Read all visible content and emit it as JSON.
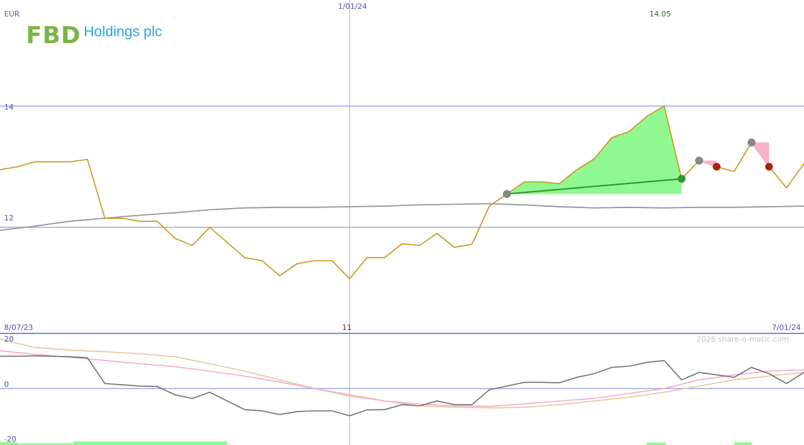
{
  "logo": {
    "letters": "FBD",
    "word": "Holdings plc"
  },
  "copyright": "2026 share-o-matic.com",
  "colors": {
    "price": "#c8941c",
    "ma": "#999999",
    "gain_fill": "#90f890",
    "gain_line": "#2a9a2a",
    "loss_fill": "#f8b4c8",
    "loss_marker": "#b02010",
    "neutral_marker": "#888888",
    "gridline": "#a0a8e8",
    "axis_text": "#4b55b0",
    "date_text": "#4b55b0",
    "accent_text": "#207020",
    "osc_price": "#707070",
    "osc_pink": "#f4a8c8",
    "osc_tan": "#e4c89c",
    "volume": "#90f890"
  },
  "chart_data": [
    {
      "type": "line",
      "name": "price-panel",
      "currency_label": "EUR",
      "ylim": [
        10.25,
        15.75
      ],
      "yticks": [
        {
          "value": 14,
          "label": "14"
        },
        {
          "value": 12,
          "label": "12"
        }
      ],
      "x_start_label": "8/07/23",
      "x_mid_label": "1/01/24",
      "x_end_label": "7/01/24",
      "highlight_label": "14.05",
      "x_range": [
        0,
        46
      ],
      "x_mid_index": 20,
      "price_series": {
        "x": [
          0,
          1,
          2,
          3,
          4,
          5,
          6,
          7,
          8,
          9,
          10,
          11,
          12,
          13,
          14,
          15,
          16,
          17,
          18,
          19,
          20,
          21,
          22,
          23,
          24,
          25,
          26,
          27,
          28,
          29,
          30,
          31,
          32,
          33,
          34,
          35,
          36,
          37,
          38,
          39,
          40,
          41,
          42,
          43,
          44,
          45,
          46
        ],
        "y": [
          12.95,
          13.0,
          13.08,
          13.08,
          13.08,
          13.12,
          12.15,
          12.15,
          12.1,
          12.1,
          11.82,
          11.7,
          12.0,
          11.75,
          11.5,
          11.45,
          11.2,
          11.4,
          11.45,
          11.45,
          11.15,
          11.5,
          11.5,
          11.73,
          11.7,
          11.9,
          11.67,
          11.72,
          12.35,
          12.55,
          12.75,
          12.75,
          12.72,
          12.95,
          13.13,
          13.48,
          13.58,
          13.83,
          14.0,
          12.8,
          13.1,
          13.0,
          12.92,
          13.4,
          13.0,
          12.65,
          13.05
        ]
      },
      "ma_series": {
        "x": [
          0,
          2,
          4,
          6,
          8,
          10,
          12,
          14,
          16,
          18,
          20,
          22,
          24,
          26,
          28,
          30,
          32,
          34,
          36,
          38,
          40,
          42,
          44,
          46
        ],
        "y": [
          11.95,
          12.02,
          12.1,
          12.15,
          12.2,
          12.24,
          12.29,
          12.32,
          12.33,
          12.33,
          12.34,
          12.35,
          12.37,
          12.38,
          12.39,
          12.37,
          12.34,
          12.32,
          12.33,
          12.32,
          12.33,
          12.33,
          12.34,
          12.35
        ]
      },
      "trades": [
        {
          "type": "gain",
          "entry": {
            "x": 29,
            "y": 12.55
          },
          "exit": {
            "x": 39,
            "y": 12.8
          }
        },
        {
          "type": "loss",
          "entry": {
            "x": 40,
            "y": 13.1
          },
          "exit": {
            "x": 41,
            "y": 13.0
          }
        },
        {
          "type": "loss",
          "entry": {
            "x": 43,
            "y": 13.4
          },
          "exit": {
            "x": 44,
            "y": 13.0
          }
        }
      ]
    },
    {
      "type": "line",
      "name": "oscillator-panel",
      "center_label": "11",
      "ylim": [
        -20,
        20
      ],
      "yticks": [
        {
          "value": 20,
          "label": "20"
        },
        {
          "value": 0,
          "label": "0"
        },
        {
          "value": -20,
          "label": "-20"
        }
      ],
      "x_range": [
        0,
        46
      ],
      "series": [
        {
          "x": [
            0,
            1,
            2,
            3,
            4,
            5,
            6,
            7,
            8,
            9,
            10,
            11,
            12,
            13,
            14,
            15,
            16,
            17,
            18,
            19,
            20,
            21,
            22,
            23,
            24,
            25,
            26,
            27,
            28,
            29,
            30,
            31,
            32,
            33,
            34,
            35,
            36,
            37,
            38,
            39,
            40,
            41,
            42,
            43,
            44,
            45,
            46
          ],
          "y": [
            13,
            13,
            13.2,
            13,
            12.8,
            12.4,
            2,
            1.5,
            1,
            0.8,
            -2.5,
            -4,
            -1.5,
            -5,
            -8.5,
            -9,
            -10.5,
            -9.3,
            -9,
            -9,
            -11,
            -8.6,
            -8.5,
            -6.5,
            -7,
            -5,
            -6.5,
            -6.5,
            -0.5,
            1,
            2.5,
            2.5,
            2.3,
            4.5,
            6,
            8.5,
            9,
            10.5,
            11.3,
            3.5,
            6.5,
            5.5,
            4.5,
            8.5,
            6,
            2,
            6.5
          ]
        },
        {
          "x": [
            0,
            2,
            4,
            6,
            8,
            10,
            12,
            14,
            16,
            18,
            20,
            22,
            24,
            26,
            28,
            30,
            32,
            34,
            36,
            38,
            40,
            42,
            44,
            46
          ],
          "y": [
            15.2,
            13.8,
            12.6,
            11.3,
            10,
            8.8,
            7,
            5,
            2.6,
            0,
            -3,
            -5,
            -6.3,
            -7,
            -7.2,
            -6.2,
            -5,
            -4,
            -2,
            0,
            3.5,
            5.5,
            7,
            7.5
          ]
        },
        {
          "x": [
            0,
            2,
            4,
            6,
            8,
            10,
            12,
            14,
            16,
            18,
            20,
            22,
            24,
            26,
            28,
            30,
            32,
            34,
            36,
            38,
            40,
            42,
            44,
            46
          ],
          "y": [
            20,
            16.5,
            15.5,
            14.8,
            14,
            12.8,
            10,
            7,
            3.5,
            0,
            -2.5,
            -5,
            -7,
            -7.5,
            -7.8,
            -7.6,
            -6.5,
            -5,
            -3.5,
            -1.5,
            1,
            3.5,
            5,
            6.5
          ]
        }
      ],
      "volume_bars": [
        {
          "x0": 0,
          "x1": 1.0,
          "level": 0.9
        },
        {
          "x0": 1.0,
          "x1": 4.2,
          "level": 0.5
        },
        {
          "x0": 4.2,
          "x1": 13,
          "level": 1.0
        },
        {
          "x0": 37,
          "x1": 38.1,
          "level": 0.7
        },
        {
          "x0": 42,
          "x1": 43,
          "level": 0.8
        }
      ]
    }
  ]
}
